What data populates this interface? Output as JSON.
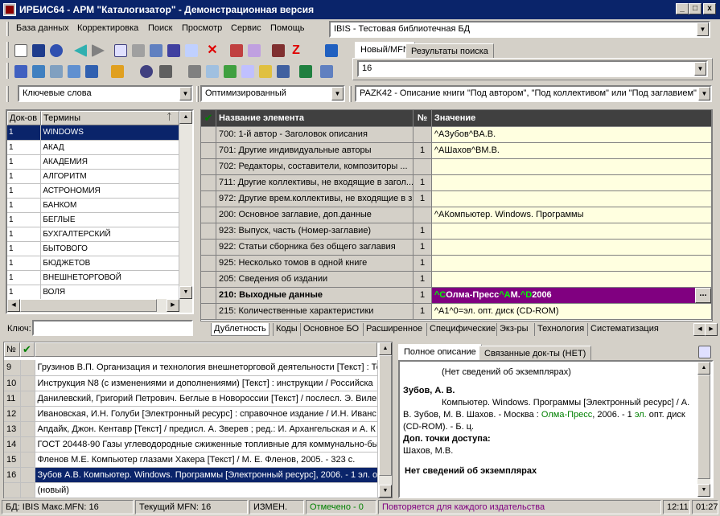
{
  "window": {
    "title": "ИРБИС64 - АРМ \"Каталогизатор\" - Демонстрационная версия",
    "min": "_",
    "max": "□",
    "close": "x"
  },
  "menu": [
    "База данных",
    "Корректировка",
    "Поиск",
    "Просмотр",
    "Сервис",
    "Помощь"
  ],
  "db_select": "IBIS - Тестовая библиотечная БД",
  "tabs_top": [
    "Новый/MFN",
    "Результаты поиска"
  ],
  "mfn_value": "16",
  "search_mode": "Ключевые слова",
  "display_mode": "Оптимизированный",
  "worksheet": "PAZK42 - Описание книги \"Под автором\", \"Под коллективом\" или \"Под заглавием\"",
  "dict": {
    "col1": "Док-ов",
    "col2": "Термины",
    "pin": "ᛏ",
    "rows": [
      [
        "1",
        "WINDOWS"
      ],
      [
        "1",
        "АКАД"
      ],
      [
        "1",
        "АКАДЕМИЯ"
      ],
      [
        "1",
        "АЛГОРИТМ"
      ],
      [
        "1",
        "АСТРОНОМИЯ"
      ],
      [
        "1",
        "БАНКОМ"
      ],
      [
        "1",
        "БЕГЛЫЕ"
      ],
      [
        "1",
        "БУХГАЛТЕРСКИЙ"
      ],
      [
        "1",
        "БЫТОВОГО"
      ],
      [
        "1",
        "БЮДЖЕТОВ"
      ],
      [
        "1",
        "ВНЕШНЕТОРГОВОЙ"
      ],
      [
        "1",
        "ВОЛЯ"
      ]
    ],
    "key_label": "Ключ:"
  },
  "fields": {
    "check": "✔",
    "col_name": "Название элемента",
    "col_no": "№",
    "col_value": "Значение",
    "rows": [
      {
        "name": "700: 1-й автор - Заголовок описания",
        "no": "",
        "value": "^AЗубов^BA.B.",
        "bold": false
      },
      {
        "name": "701: Другие индивидуальные авторы",
        "no": "1",
        "value": "^AШахов^BМ.В.",
        "bold": false
      },
      {
        "name": "702: Редакторы, составители, композиторы ...",
        "no": "",
        "value": "",
        "bold": false
      },
      {
        "name": "711: Другие коллективы, не входящие в загол...",
        "no": "1",
        "value": "",
        "bold": false
      },
      {
        "name": "972: Другие врем.коллективы, не входящие в з...",
        "no": "1",
        "value": "",
        "bold": false
      },
      {
        "name": "200: Основное заглавие, доп.данные",
        "no": "",
        "value": "^AКомпьютер. Windows. Программы",
        "bold": false
      },
      {
        "name": "923: Выпуск, часть (Номер-заглавие)",
        "no": "1",
        "value": "",
        "bold": false
      },
      {
        "name": "922: Статьи сборника без общего заглавия",
        "no": "1",
        "value": "",
        "bold": false
      },
      {
        "name": "925: Несколько томов в одной книге",
        "no": "1",
        "value": "",
        "bold": false
      },
      {
        "name": "205: Сведения об издании",
        "no": "1",
        "value": "",
        "bold": false
      },
      {
        "name": "210: Выходные данные",
        "no": "1",
        "value": "",
        "bold": true
      },
      {
        "name": "215: Количественные характеристики",
        "no": "1",
        "value": "^A1^0=эл. опт. диск (CD-ROM)",
        "bold": false
      }
    ],
    "edit_row": {
      "p1": "^C",
      "p2": "Олма-Пресс",
      "p3": "^A",
      "p4": "М.",
      "p5": "^D",
      "p6": "2006",
      "btn": "..."
    }
  },
  "bottom_tabs": [
    "Дублетность",
    "Коды",
    "Основное БО",
    "Расширенное",
    "Специфические",
    "Экз-ры",
    "Технология",
    "Систематизация"
  ],
  "docs": {
    "col_no": "№",
    "check": "✔",
    "rows": [
      {
        "n": "9",
        "t": "Грузинов В.П. Организация и технология внешнеторговой деятельности [Текст] : Те"
      },
      {
        "n": "10",
        "t": "Инструкция N8   (с изменениями и дополнениями) [Текст] : инструкции / Российска"
      },
      {
        "n": "11",
        "t": "Данилевский, Григорий Петрович. Беглые в Новороссии [Текст] / послесл. Э. Вилен"
      },
      {
        "n": "12",
        "t": "Ивановская, И.Н. Голуби [Электронный ресурс] : справочное издание / И.Н. Иванс"
      },
      {
        "n": "13",
        "t": "Апдайк, Джон. Кентавр [Текст] / предисл. А. Зверев ; ред.: И. Архангельская и А. К"
      },
      {
        "n": "14",
        "t": "ГОСТ 20448-90 Газы углеводородные сжиженные топливные для коммунально-быт"
      },
      {
        "n": "15",
        "t": "Фленов М.Е. Компьютер глазами Хакера [Текст] / М. Е. Фленов, 2005. - 323 с."
      },
      {
        "n": "16",
        "t": "Зубов А.В. Компьютер. Windows. Программы [Электронный ресурс], 2006. - 1 эл. о"
      },
      {
        "n": "",
        "t": "(новый)"
      }
    ]
  },
  "desc_tabs": [
    "Полное описание",
    "Связанные док-ты (НЕТ)"
  ],
  "desc": {
    "no_copies1": "(Нет сведений об экземплярах)",
    "author": "Зубов, А. В.",
    "body1": "Компьютер. Windows. Программы [Электронный ресурс] / А. В. Зубов, М. В. Шахов. - Москва : ",
    "publisher": "Олма-Пресс",
    "body2": ", 2006. - 1 ",
    "unit": "эл.",
    "body3": " опт. диск (CD-ROM). - Б. ц.",
    "access_label": "Доп. точки доступа:",
    "access_val": "Шахов, М.В.",
    "no_copies2": "Нет сведений об экземплярах"
  },
  "status": {
    "db": "БД: IBIS Макс.MFN: 16",
    "cur": "Текущий MFN: 16",
    "changed": "ИЗМЕН.",
    "marked": "Отмечено - 0",
    "hint": "Повторяется для каждого издательства",
    "time": "12:11",
    "time2": "01:27"
  },
  "colors": {
    "title": "#0a246a",
    "selected": "#0a246a",
    "edit": "#800080",
    "green": "#008000",
    "hint": "#800080",
    "value_bg": "#ffffe0"
  }
}
